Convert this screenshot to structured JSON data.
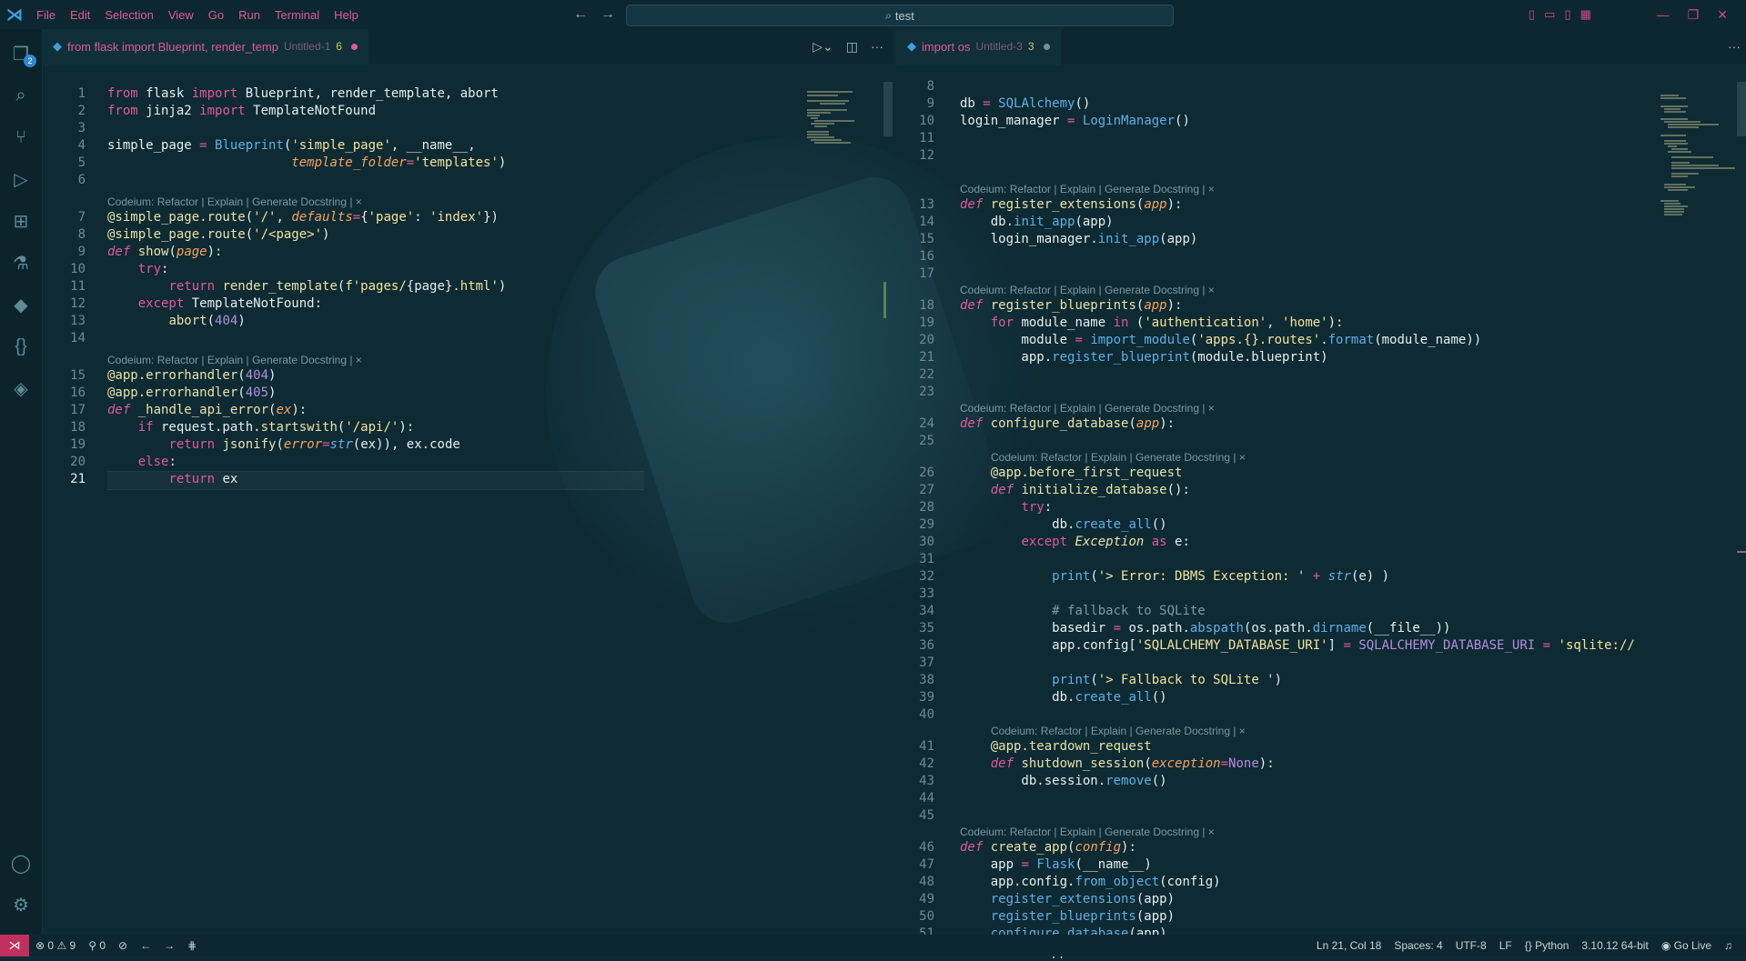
{
  "titlebar": {
    "menu": [
      "File",
      "Edit",
      "Selection",
      "View",
      "Go",
      "Run",
      "Terminal",
      "Help"
    ],
    "search": "test"
  },
  "activity": {
    "explorer_badge": "2"
  },
  "editor1": {
    "tab": {
      "name": "from flask import Blueprint, render_temp",
      "desc": "Untitled-1",
      "count": "6"
    },
    "codelens": "Codeium: Refactor | Explain | Generate Docstring | ×"
  },
  "editor2": {
    "tab": {
      "name": "import os",
      "desc": "Untitled-3",
      "count": "3"
    }
  },
  "statusbar": {
    "errors": "0",
    "warnings": "9",
    "ports": "0",
    "position": "Ln 21, Col 18",
    "spaces": "Spaces: 4",
    "encoding": "UTF-8",
    "eol": "LF",
    "language": "Python",
    "interpreter": "3.10.12 64-bit",
    "golive": "Go Live"
  },
  "colors": {
    "accent": "#e05a98",
    "background": "#0e2a33",
    "remote": "#c0305f"
  }
}
